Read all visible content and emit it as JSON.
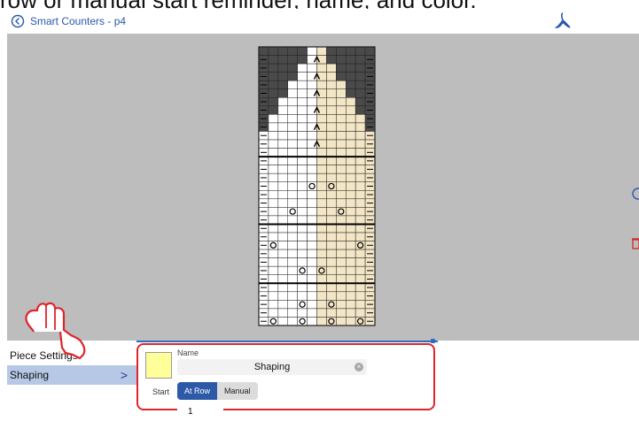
{
  "caption_text": "row or manual start reminder, name, and color.",
  "topbar": {
    "back_label": "Smart Counters - p4",
    "back_icon": "chevron-left-circle-icon",
    "pdf_icon": "adobe-acrobat-icon"
  },
  "knitting_chart": {
    "columns": 12,
    "rows": 33,
    "dark_rows": 13,
    "colors": {
      "dark": "#4a4a4a",
      "white": "#ffffff",
      "cream": "#f3e6c6",
      "grid": "#202020"
    }
  },
  "panel": {
    "side_items": [
      {
        "label": "Piece Settings"
      },
      {
        "label": "Shaping",
        "chevron": ">"
      }
    ],
    "name_label": "Name",
    "name_value": "Shaping",
    "swatch_color": "#ffff99",
    "start_label": "Start",
    "start_options": [
      "At Row",
      "Manual"
    ],
    "start_selected": "At Row",
    "row_value": "1"
  },
  "colors": {
    "accent": "#2d5aa8",
    "highlight_box": "#e0242c",
    "canvas_bg": "#bdbdbd",
    "selection_bg": "#b6c8e6"
  }
}
